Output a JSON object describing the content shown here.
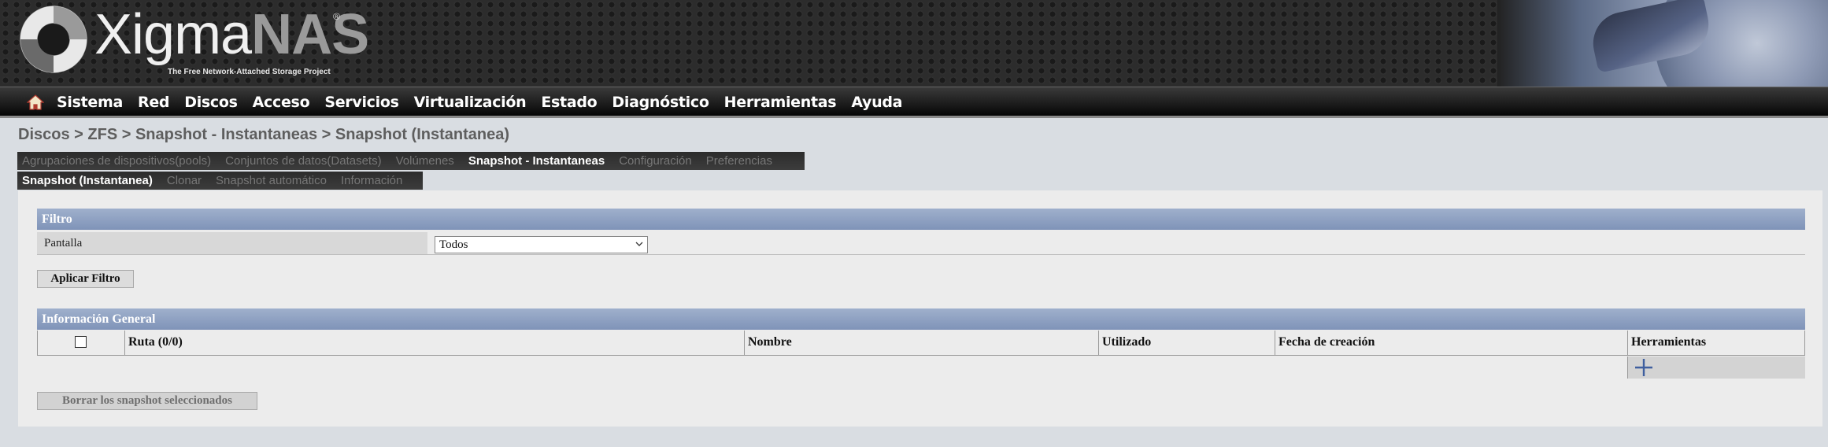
{
  "header": {
    "logo_main": "Xigma",
    "logo_accent": "NAS",
    "logo_reg": "®",
    "tagline": "The Free Network-Attached Storage Project"
  },
  "nav": {
    "home_icon": "home-icon",
    "items": [
      "Sistema",
      "Red",
      "Discos",
      "Acceso",
      "Servicios",
      "Virtualización",
      "Estado",
      "Diagnóstico",
      "Herramientas",
      "Ayuda"
    ]
  },
  "breadcrumb": "Discos > ZFS > Snapshot - Instantaneas > Snapshot (Instantanea)",
  "tabs_primary": [
    "Agrupaciones de dispositivos(pools)",
    "Conjuntos de datos(Datasets)",
    "Volúmenes",
    "Snapshot - Instantaneas",
    "Configuración",
    "Preferencias"
  ],
  "tabs_primary_active": "Snapshot - Instantaneas",
  "tabs_secondary": [
    "Snapshot (Instantanea)",
    "Clonar",
    "Snapshot automático",
    "Información"
  ],
  "tabs_secondary_active": "Snapshot (Instantanea)",
  "filter": {
    "title": "Filtro",
    "label": "Pantalla",
    "selected": "Todos",
    "apply_button": "Aplicar Filtro"
  },
  "general": {
    "title": "Información General",
    "columns": [
      "Ruta (0/0)",
      "Nombre",
      "Utilizado",
      "Fecha de creación",
      "Herramientas"
    ],
    "add_icon": "plus-icon",
    "delete_button": "Borrar los snapshot seleccionados"
  },
  "colors": {
    "section_bar": "#8a9cbf",
    "header_bg": "#222222",
    "nav_text": "#ffffff"
  }
}
